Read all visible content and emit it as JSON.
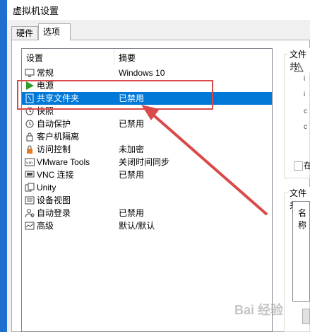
{
  "window": {
    "title": "虚拟机设置"
  },
  "tabs": [
    {
      "label": "硬件",
      "active": false
    },
    {
      "label": "选项",
      "active": true
    }
  ],
  "settings_list": {
    "headers": {
      "setting": "设置",
      "summary": "摘要"
    },
    "rows": [
      {
        "name": "常规",
        "summary": "Windows 10",
        "icon": "monitor-icon",
        "selected": false
      },
      {
        "name": "电源",
        "summary": "",
        "icon": "power-play-icon",
        "selected": false
      },
      {
        "name": "共享文件夹",
        "summary": "已禁用",
        "icon": "shared-folder-icon",
        "selected": true
      },
      {
        "name": "快照",
        "summary": "",
        "icon": "snapshot-icon",
        "selected": false
      },
      {
        "name": "自动保护",
        "summary": "已禁用",
        "icon": "autoprotect-icon",
        "selected": false
      },
      {
        "name": "客户机隔离",
        "summary": "",
        "icon": "lock-icon",
        "selected": false
      },
      {
        "name": "访问控制",
        "summary": "未加密",
        "icon": "access-lock-icon",
        "selected": false
      },
      {
        "name": "VMware Tools",
        "summary": "关闭时间同步",
        "icon": "vm-tools-icon",
        "selected": false
      },
      {
        "name": "VNC 连接",
        "summary": "已禁用",
        "icon": "vnc-icon",
        "selected": false
      },
      {
        "name": "Unity",
        "summary": "",
        "icon": "unity-icon",
        "selected": false
      },
      {
        "name": "设备视图",
        "summary": "",
        "icon": "device-view-icon",
        "selected": false
      },
      {
        "name": "自动登录",
        "summary": "已禁用",
        "icon": "autologin-icon",
        "selected": false
      },
      {
        "name": "高级",
        "summary": "默认/默认",
        "icon": "advanced-icon",
        "selected": false
      }
    ]
  },
  "right_panel": {
    "group1_label": "文件共",
    "checkbox_label": "在",
    "group2_label": "文件共",
    "file_column": "名称"
  },
  "watermark": "Bai 经验",
  "colors": {
    "selection": "#0078d7",
    "annotation_red": "#d94a4a",
    "taskbar_blue": "#1f6fd1"
  }
}
